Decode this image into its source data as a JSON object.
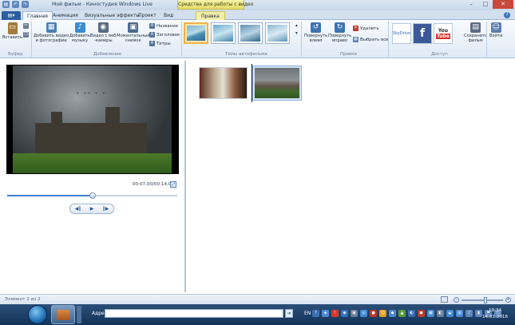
{
  "window": {
    "title": "Мой фильм - Киностудия Windows Live",
    "context_header": "Средства для работы с видео"
  },
  "tabs": [
    "Главная",
    "Анимация",
    "Визуальные эффекты",
    "Проект",
    "Вид"
  ],
  "context_tab": "Правка",
  "ribbon": {
    "clipboard": {
      "paste": "Вставить",
      "group": "Буфер"
    },
    "add": {
      "add_media": [
        "Добавить видео",
        "и фотографии"
      ],
      "add_music": [
        "Добавить",
        "музыку"
      ],
      "webcam": [
        "Видео с веб",
        "-камеры"
      ],
      "snapshot": [
        "Моментальный",
        "снимок"
      ],
      "caption": "Название",
      "heading": "Заголовок",
      "titles": "Титры",
      "group": "Добавление"
    },
    "themes": {
      "group": "Темы автофильма"
    },
    "edit": {
      "rotate_left": [
        "Повернуть",
        "влево"
      ],
      "rotate_right": [
        "Повернуть",
        "вправо"
      ],
      "delete": "Удалить",
      "select_all": "Выбрать все",
      "group": "Правка"
    },
    "access": {
      "skydrive": "SkyDrive",
      "save_movie": [
        "Сохранить",
        "фильм"
      ],
      "signin": "Войти",
      "group": "Доступ"
    }
  },
  "player": {
    "time": "00:07,00/00:14,00",
    "progress": 0.5
  },
  "status": {
    "text": "Элемент 2 из 2",
    "zoom": 0.58
  },
  "taskbar": {
    "address_label": "Адрес",
    "lang": "EN",
    "time": "19:34",
    "date": "14.01.2016"
  }
}
